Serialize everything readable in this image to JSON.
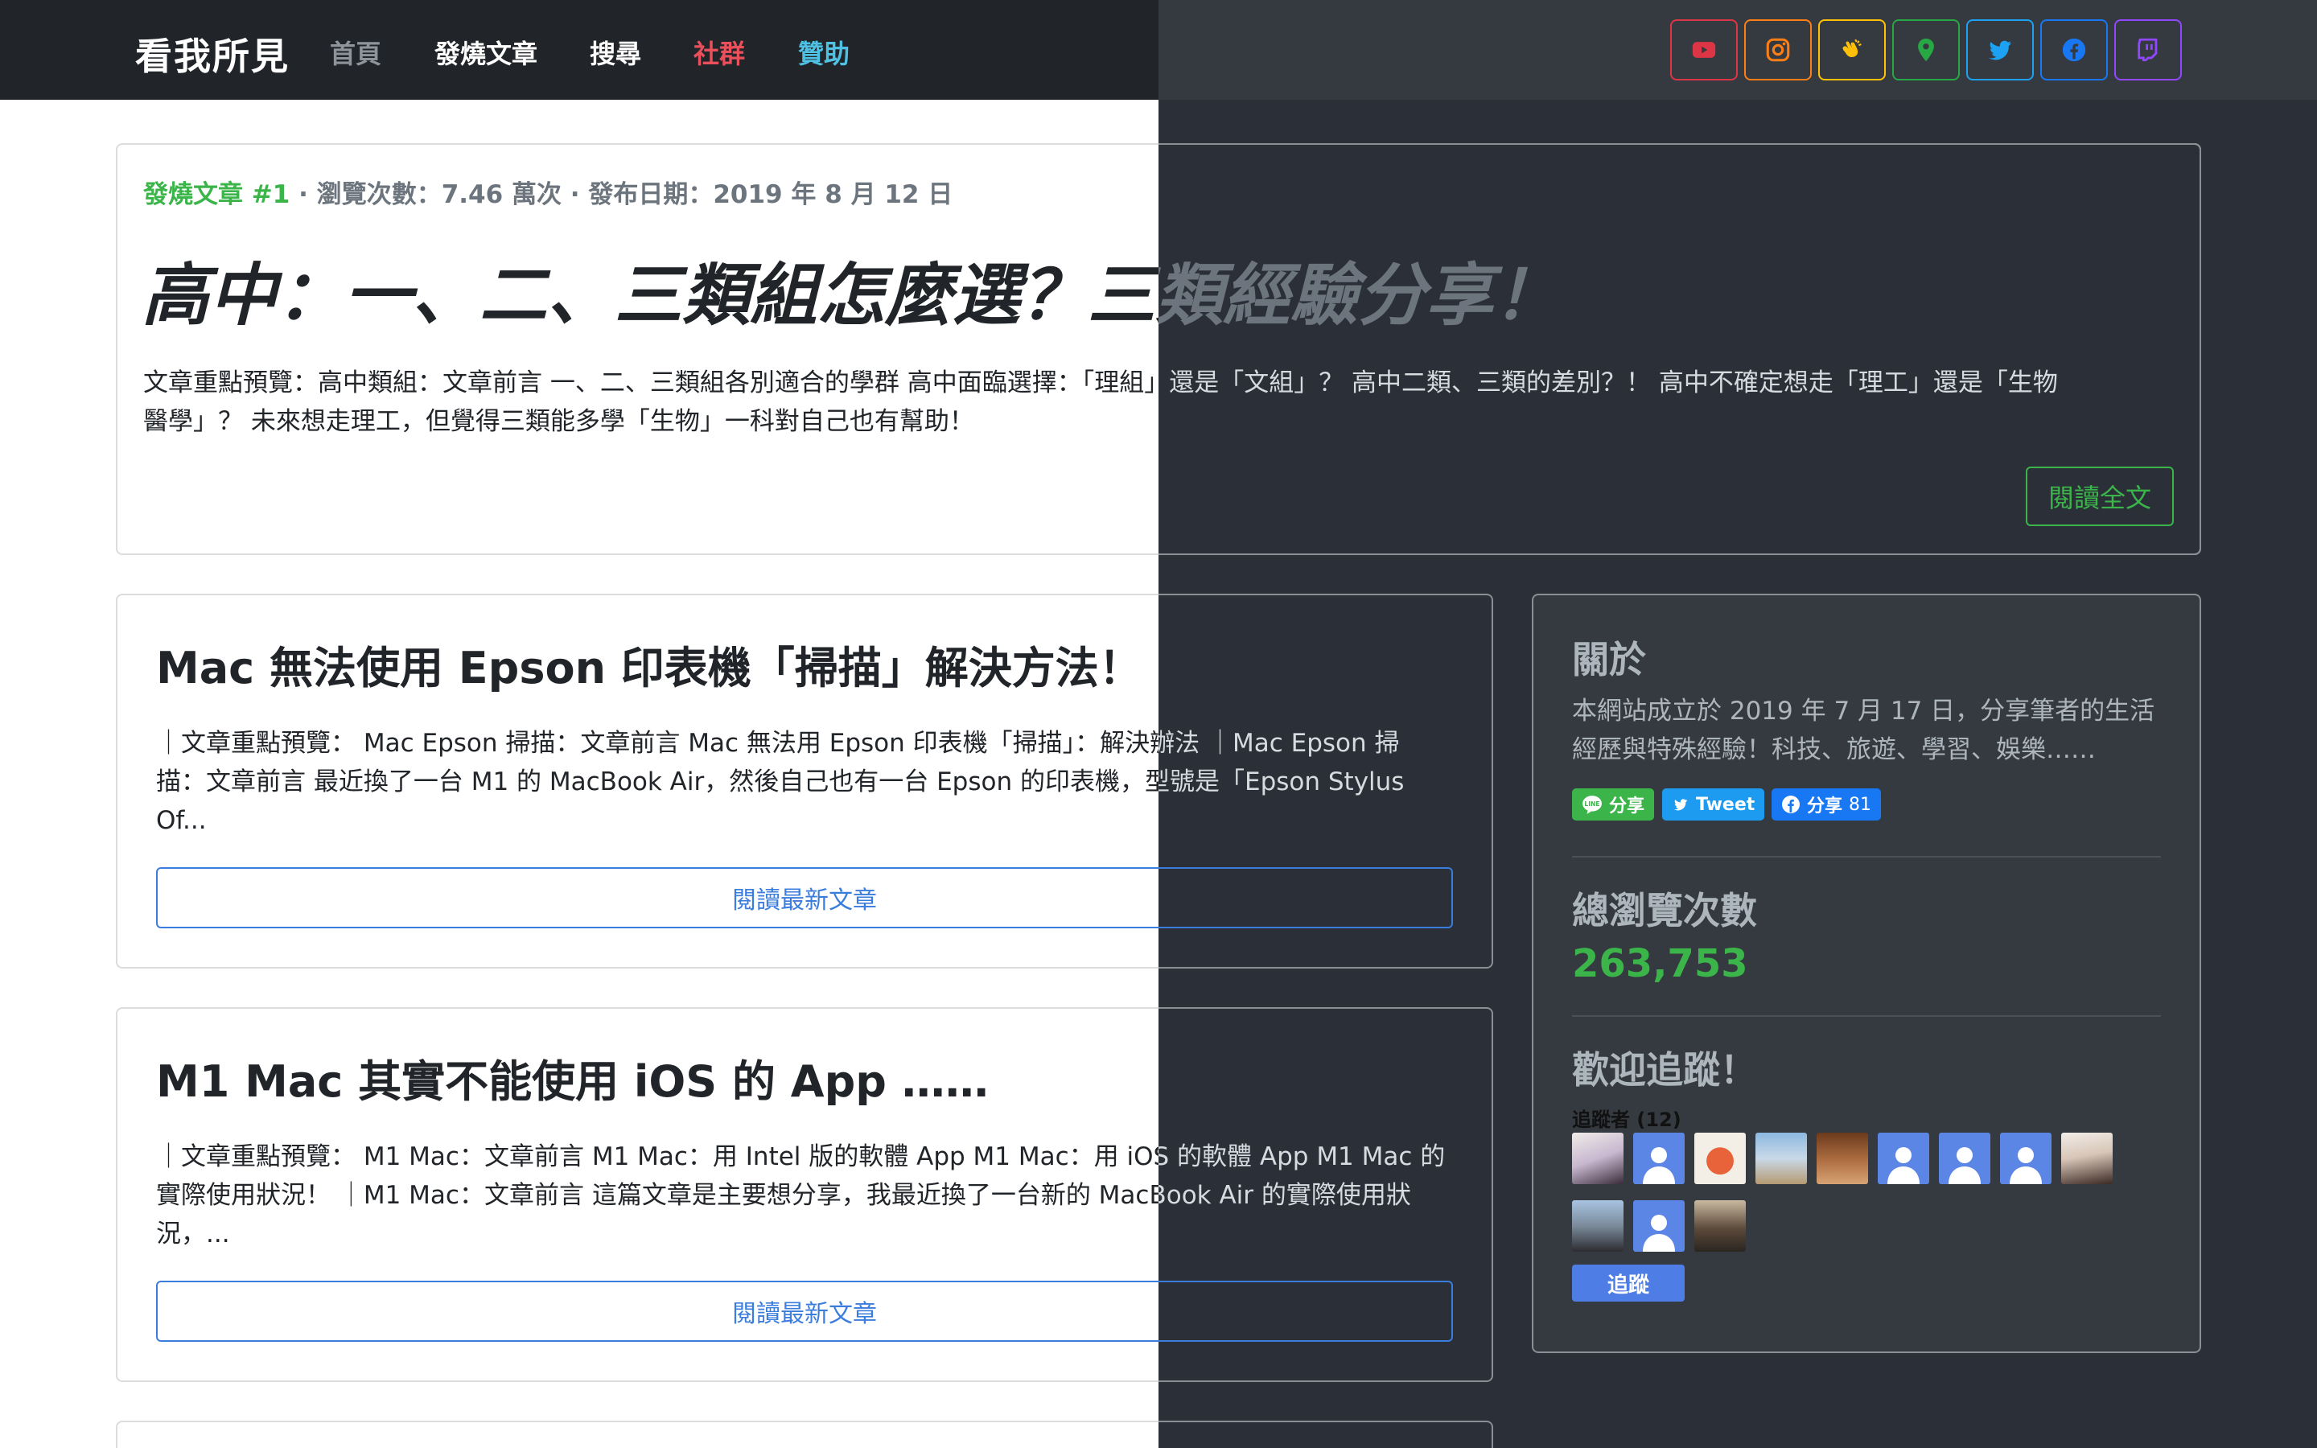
{
  "nav": {
    "brand": "看我所見",
    "links": [
      {
        "label": "首頁",
        "color": "#8e949a"
      },
      {
        "label": "發燒文章",
        "color": "#ffffff"
      },
      {
        "label": "搜尋",
        "color": "#ffffff"
      },
      {
        "label": "社群",
        "color": "#e9505c"
      },
      {
        "label": "贊助",
        "color": "#4fc1e3"
      }
    ],
    "social": [
      {
        "icon": "youtube-icon",
        "color": "#dc3545"
      },
      {
        "icon": "instagram-icon",
        "color": "#fd7e14"
      },
      {
        "icon": "clap-icon",
        "color": "#ffc107"
      },
      {
        "icon": "map-pin-icon",
        "color": "#28a745"
      },
      {
        "icon": "twitter-icon",
        "color": "#1da1f2"
      },
      {
        "icon": "facebook-icon",
        "color": "#1877f2"
      },
      {
        "icon": "twitch-icon",
        "color": "#9146ff"
      }
    ]
  },
  "featured": {
    "tag": "發燒文章 #1",
    "meta": " · 瀏覽次數：7.46 萬次 · 發布日期：2019 年 8 月 12 日",
    "title": "高中：一、二、三類組怎麼選？三類經驗分享！",
    "excerpt_line1": "文章重點預覽：高中類組：文章前言 一、二、三類組各別適合的學群 高中面臨選擇：「理組」還是「文組」？ 高中二類、三類的差別？！ 高中不確定想走「理工」還是「生物",
    "excerpt_line2": "醫學」？ 未來想走理工，但覺得三類能多學「生物」一科對自己也有幫助！",
    "button": "閱讀全文"
  },
  "posts": [
    {
      "title": "Mac 無法使用 Epson 印表機「掃描」解決方法！",
      "excerpt_line1": "｜文章重點預覽： Mac Epson 掃描：文章前言 Mac 無法用 Epson 印表機「掃描」：解決辦法 ｜Mac Epson 掃",
      "excerpt_line2": "描：文章前言 最近換了一台 M1 的 MacBook Air，然後自己也有一台 Epson 的印表機，型號是「Epson Stylus",
      "excerpt_line3": "Of...",
      "button": "閱讀最新文章"
    },
    {
      "title": "M1 Mac 其實不能使用 iOS 的 App ……",
      "excerpt_line1": "｜文章重點預覽： M1 Mac：文章前言 M1 Mac：用 Intel 版的軟體 App M1 Mac：用 iOS 的軟體 App M1 Mac 的",
      "excerpt_line2": "實際使用狀況！ ｜M1 Mac：文章前言 這篇文章是主要想分享，我最近換了一台新的 MacBook Air 的實際使用狀",
      "excerpt_line3": "況，...",
      "button": "閱讀最新文章"
    }
  ],
  "sidebar": {
    "about_title": "關於",
    "about_line1": "本網站成立於 2019 年 7 月 17 日，分享筆者的生活",
    "about_line2": "經歷與特殊經驗！科技、旅遊、學習、娛樂……",
    "share_line": "分享",
    "share_tweet": "Tweet",
    "share_fb": "分享",
    "share_fb_count": "81",
    "views_title": "總瀏覽次數",
    "views_value": "263,753",
    "follow_title": "歡迎追蹤！",
    "followers_label": "追蹤者 (12)",
    "follow_button": "追蹤"
  },
  "colors": {
    "green": "#3bb54a",
    "blue": "#3b7ddd",
    "dark_bg": "#2b2f37"
  }
}
